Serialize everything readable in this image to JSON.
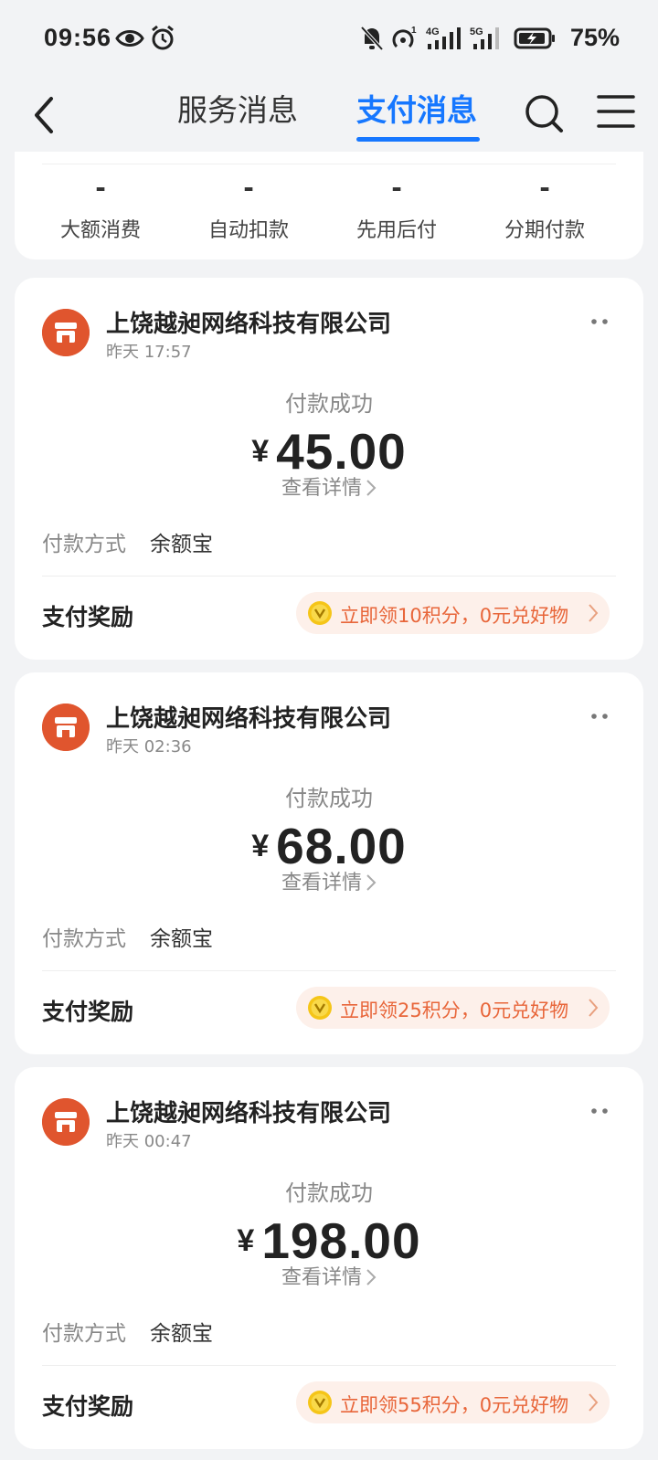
{
  "status_bar": {
    "time": "09:56",
    "battery": "75%",
    "icons": [
      "eye-icon",
      "alarm-icon",
      "mute-bell-icon",
      "hotspot-icon",
      "4g-signal-icon",
      "5g-signal-icon",
      "battery-charging-icon"
    ]
  },
  "header": {
    "tabs": [
      {
        "label": "服务消息",
        "active": false
      },
      {
        "label": "支付消息",
        "active": true
      }
    ],
    "accent": "#1677ff"
  },
  "summary": {
    "items": [
      {
        "value": "-",
        "label": "大额消费"
      },
      {
        "value": "-",
        "label": "自动扣款"
      },
      {
        "value": "-",
        "label": "先用后付"
      },
      {
        "value": "-",
        "label": "分期付款"
      }
    ]
  },
  "payments": [
    {
      "merchant": "上饶越昶网络科技有限公司",
      "time": "昨天 17:57",
      "status": "付款成功",
      "currency": "¥",
      "amount": "45.00",
      "detail": "查看详情",
      "method_label": "付款方式",
      "method_value": "余额宝",
      "reward_label": "支付奖励",
      "reward_text": "立即领10积分，0元兑好物"
    },
    {
      "merchant": "上饶越昶网络科技有限公司",
      "time": "昨天 02:36",
      "status": "付款成功",
      "currency": "¥",
      "amount": "68.00",
      "detail": "查看详情",
      "method_label": "付款方式",
      "method_value": "余额宝",
      "reward_label": "支付奖励",
      "reward_text": "立即领25积分，0元兑好物"
    },
    {
      "merchant": "上饶越昶网络科技有限公司",
      "time": "昨天 00:47",
      "status": "付款成功",
      "currency": "¥",
      "amount": "198.00",
      "detail": "查看详情",
      "method_label": "付款方式",
      "method_value": "余额宝",
      "reward_label": "支付奖励",
      "reward_text": "立即领55积分，0元兑好物"
    }
  ],
  "colors": {
    "merchant_avatar": "#e0552e",
    "reward_text": "#e8663a",
    "reward_bg": "#fdf0ea",
    "coin": "#f5c518"
  }
}
